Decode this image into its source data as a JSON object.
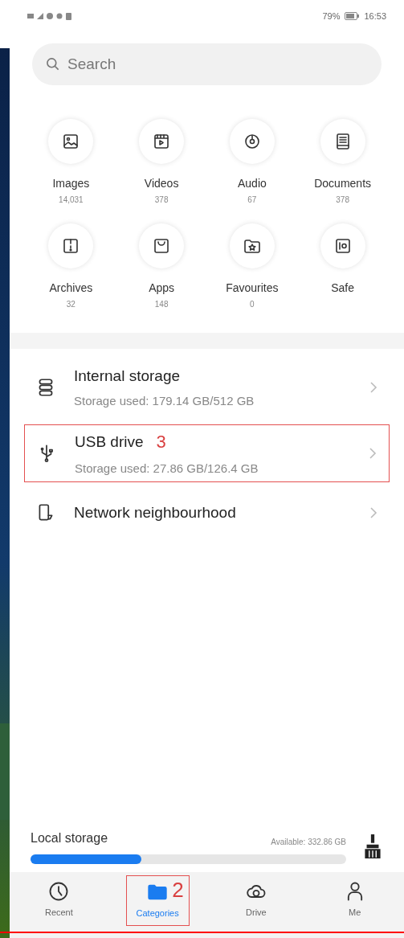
{
  "status_bar": {
    "battery": "79%",
    "time": "16:53"
  },
  "search": {
    "placeholder": "Search"
  },
  "categories": [
    {
      "kind": "images",
      "label": "Images",
      "count": "14,031"
    },
    {
      "kind": "videos",
      "label": "Videos",
      "count": "378"
    },
    {
      "kind": "audio",
      "label": "Audio",
      "count": "67"
    },
    {
      "kind": "documents",
      "label": "Documents",
      "count": "378"
    },
    {
      "kind": "archives",
      "label": "Archives",
      "count": "32"
    },
    {
      "kind": "apps",
      "label": "Apps",
      "count": "148"
    },
    {
      "kind": "favourites",
      "label": "Favourites",
      "count": "0"
    },
    {
      "kind": "safe",
      "label": "Safe"
    }
  ],
  "locations": [
    {
      "kind": "internal",
      "title": "Internal storage",
      "detail": "Storage used: 179.14 GB/512 GB"
    },
    {
      "kind": "usb",
      "title": "USB drive",
      "detail": "Storage used: 27.86 GB/126.4 GB",
      "annotation": "3"
    },
    {
      "kind": "network",
      "title": "Network neighbourhood"
    }
  ],
  "local_storage": {
    "title": "Local storage",
    "available": "Available: 332.86 GB",
    "level": 0.35
  },
  "bottom_nav": [
    {
      "kind": "recent",
      "label": "Recent",
      "selected": false
    },
    {
      "kind": "categories",
      "label": "Categories",
      "selected": true,
      "annotation": "2"
    },
    {
      "kind": "drive",
      "label": "Drive",
      "selected": false
    },
    {
      "kind": "me",
      "label": "Me",
      "selected": false
    }
  ]
}
